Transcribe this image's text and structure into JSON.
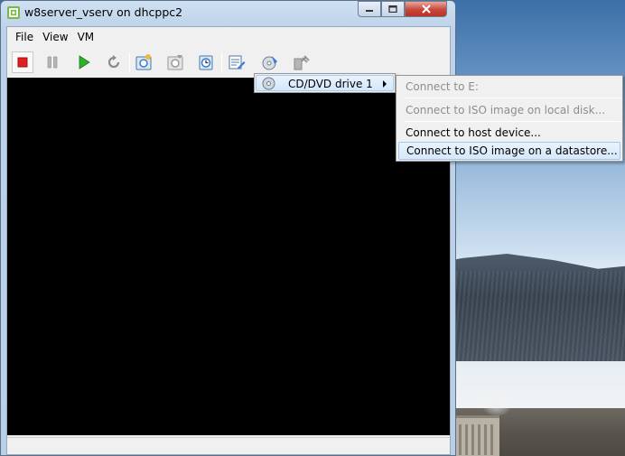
{
  "window": {
    "title": "w8server_vserv on dhcppc2"
  },
  "menubar": {
    "items": [
      "File",
      "View",
      "VM"
    ]
  },
  "toolbar": {
    "buttons": [
      "power-off",
      "suspend",
      "power-on",
      "reset",
      "take-snapshot",
      "revert-snapshot",
      "snapshot-manager",
      "cd-dvd",
      "floppy",
      "usb"
    ]
  },
  "context_menu": {
    "item": "CD/DVD drive 1",
    "submenu": [
      {
        "label": "Connect to E:",
        "enabled": false
      },
      {
        "label": "Connect to ISO image on local disk...",
        "enabled": false
      },
      {
        "label": "Connect to host device...",
        "enabled": true
      },
      {
        "label": "Connect to ISO image on a datastore...",
        "enabled": true,
        "highlighted": true
      }
    ]
  },
  "colors": {
    "console": "#000000",
    "menu_highlight": "#d6e8fb",
    "stop_red": "#e02020",
    "play_green": "#2fae2f"
  }
}
